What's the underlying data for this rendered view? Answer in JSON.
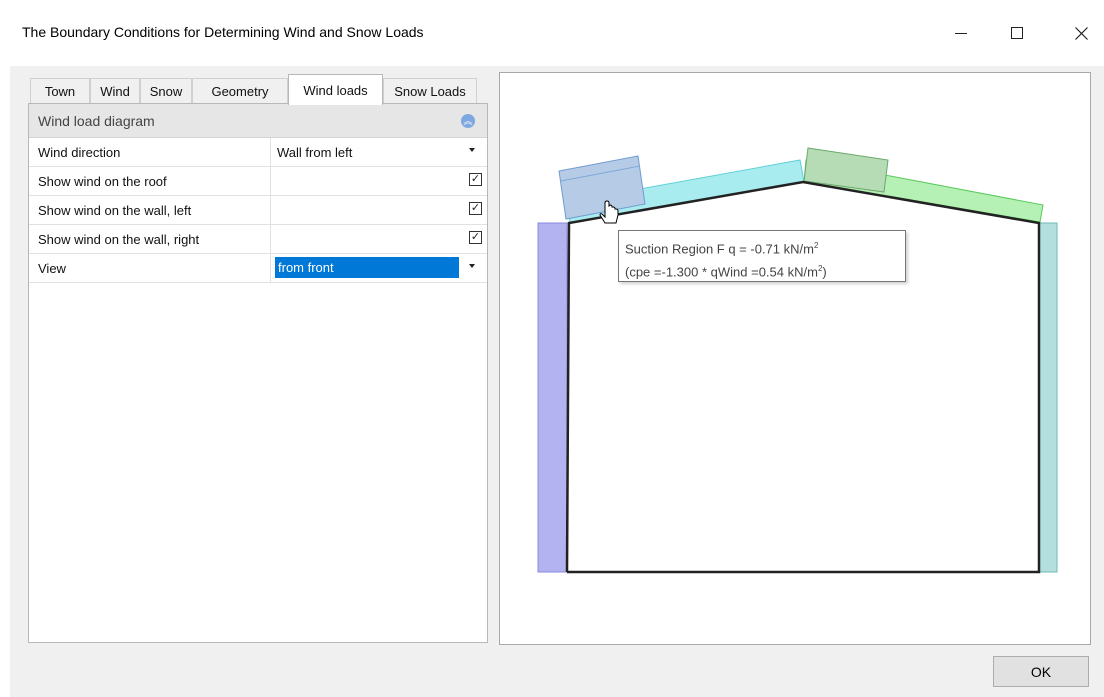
{
  "window": {
    "title": "The Boundary Conditions for Determining Wind and Snow Loads",
    "minimize_icon": "minimize-icon",
    "maximize_icon": "maximize-icon",
    "close_icon": "close-icon"
  },
  "tabs": [
    "Town",
    "Wind",
    "Snow",
    "Geometry",
    "Wind loads",
    "Snow Loads"
  ],
  "active_tab": "Wind loads",
  "property_grid": {
    "category": "Wind load diagram",
    "rows": [
      {
        "label": "Wind direction",
        "value": "Wall from left",
        "type": "dropdown"
      },
      {
        "label": "Show wind on the roof",
        "value": true,
        "type": "checkbox"
      },
      {
        "label": "Show wind on the wall, left",
        "value": true,
        "type": "checkbox"
      },
      {
        "label": "Show wind on the wall, right",
        "value": true,
        "type": "checkbox"
      },
      {
        "label": "View",
        "value": "from front",
        "type": "dropdown",
        "selected": true
      }
    ]
  },
  "tooltip": {
    "line1": "Suction Region F q = -0.71 kN/m",
    "line1_sup": "2",
    "line2": "(cpe =-1.300 *  qWind =0.54 kN/m",
    "line2_sup": "2",
    "line2_end": ")"
  },
  "diagram_colors": {
    "left_wall": "#b3b3f2",
    "right_wall": "#b3e0de",
    "roof_region_F": "#b6cce6",
    "roof_left": "#a9ecf0",
    "roof_ridge": "#b5dcb5",
    "roof_right": "#b5f0b5",
    "frame": "#222222"
  },
  "buttons": {
    "ok": "OK"
  }
}
